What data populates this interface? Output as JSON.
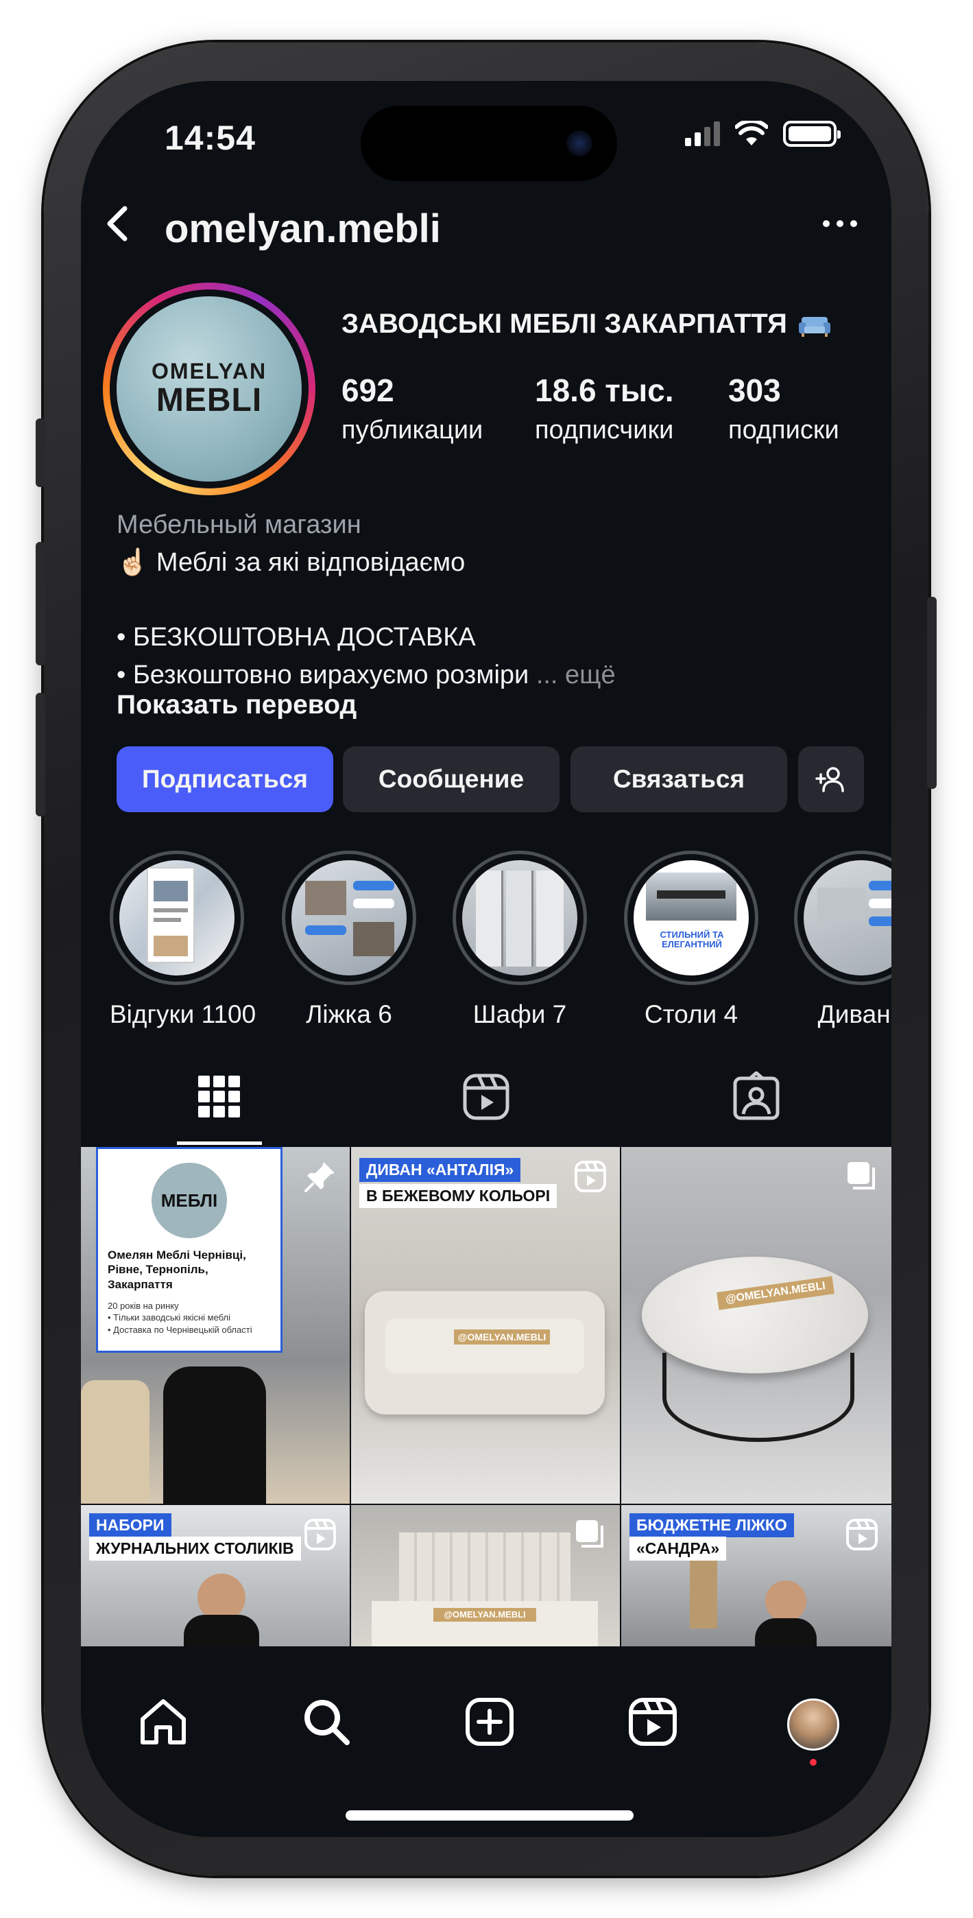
{
  "status_bar": {
    "time": "14:54"
  },
  "header": {
    "username": "omelyan.mebli"
  },
  "profile": {
    "avatar_text_line1": "OMELYAN",
    "avatar_text_line2": "MEBLI",
    "display_name": "ЗАВОДСЬКІ МЕБЛІ ЗАКАРПАТТЯ",
    "stats": [
      {
        "value": "692",
        "label": "публикации"
      },
      {
        "value": "18.6 тыс.",
        "label": "подписчики"
      },
      {
        "value": "303",
        "label": "подписки"
      }
    ],
    "category": "Мебельный магазин",
    "bio_lines": [
      "☝🏻 Меблі за які відповідаємо",
      "• БЕЗКОШТОВНА ДОСТАВКА",
      "• Безкоштовно вирахуємо розміри"
    ],
    "bio_more": "... ещё",
    "translate_label": "Показать перевод"
  },
  "actions": {
    "follow": "Подписаться",
    "message": "Сообщение",
    "contact": "Связаться"
  },
  "highlights": [
    {
      "label": "Відгуки 1100"
    },
    {
      "label": "Ліжка 6"
    },
    {
      "label": "Шафи 7"
    },
    {
      "label": "Столи 4"
    },
    {
      "label": "Дивани"
    }
  ],
  "highlight_texts": {
    "stoly_caption": "СТИЛЬНИЙ ТА ЕЛЕГАНТНИЙ"
  },
  "posts": [
    {
      "banner1": "",
      "banner2": "",
      "overlay_title": "Омелян Меблі Чернівці, Рівне, Тернопіль, Закарпаття",
      "overlay_logo": "МЕБЛІ",
      "overlay_lines": [
        "20 років на ринку",
        "• Тільки заводські якісні меблі",
        "• Доставка по Чернівецькій області"
      ]
    },
    {
      "banner1": "ДИВАН «АНТАЛІЯ»",
      "banner2": "В БЕЖЕВОМУ КОЛЬОРІ",
      "sign": "@OMELYAN.MEBLI"
    },
    {
      "banner1": "",
      "banner2": "",
      "sign": "@OMELYAN.MEBLI"
    },
    {
      "banner1": "НАБОРИ",
      "banner2": "ЖУРНАЛЬНИХ СТОЛИКІВ"
    },
    {
      "banner1": "",
      "banner2": "",
      "sign": "@OMELYAN.MEBLI"
    },
    {
      "banner1": "БЮДЖЕТНЕ ЛІЖКО",
      "banner2": "«САНДРА»"
    }
  ],
  "colors": {
    "background": "#0c0f14",
    "accent": "#4a5df9",
    "button": "#26292f",
    "muted": "#9ea3ab"
  }
}
